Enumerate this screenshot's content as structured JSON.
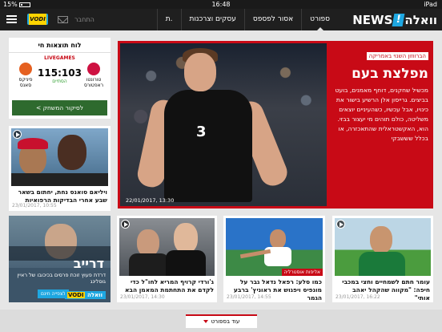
{
  "status": {
    "battery": "15%",
    "time": "16:48",
    "device": "iPad"
  },
  "brand": {
    "walla": "וואלה",
    "news": "NEWS"
  },
  "nav": [
    "ספורט",
    "אסור לפספס",
    "עסקים וצרכנות",
    "ת."
  ],
  "header": {
    "login": "התחבר",
    "vodi": "VODI"
  },
  "hero": {
    "tag": "הברווזון השנוי באמריקה",
    "title": "מפלצת בעם",
    "desc": "מכשיל שחקנים, דוחף מאמנים, בועט בביצים. גרייסון אלן הרשיע בישור את כינויו, אבל עכשיו, כשהעיניים יוצאים משליטה, כולם תוהים מי יעצור בבזי. הוא, האקשטראלית שהתאכזרה, או בכלל שששבקי",
    "date": "22/01/2017, 13:30",
    "jersey": "3"
  },
  "score": {
    "header": "לוח תוצאות חי",
    "logo": "LIVEGAMES",
    "result": "115:103",
    "status": "הסתיים",
    "home": "טורונטו ראפטורס",
    "away": "פיניקס סאנס",
    "button": "לסיקור המשחק >"
  },
  "side": {
    "title": "ויליאם סואנס נחת, יחתום בשאר שבע אחרי הבדיקות הרפואיות",
    "date": "23/01/2017, 10:55"
  },
  "ad": {
    "title": "דרייב",
    "desc": "דרדת פעוץ זוכת פרסים בכיכובו של ראיין גוסלינג",
    "cta": "לצפייה חינם",
    "vodi": "VODI",
    "walla": "וואלה"
  },
  "cards": [
    {
      "title": "ג'ורדי קרויף המריא לחו\"ל כדי לקדם את התחתמת המאמן הבא",
      "date": "23/01/2017, 14:30",
      "badge": ""
    },
    {
      "title": "כמו סלע: רפאל נדאל גבר על מונפיס ויפגוש את ראוניץ' ברבע הגמר",
      "date": "23/01/2017, 14:55",
      "badge": "אליפות אוסטרליה"
    },
    {
      "title": "עומר חתם לשמחיים וחצי במכבי חיפה: \"מקווה שהקהל יאהב אותי\"",
      "date": "23/01/2017, 16:22",
      "badge": ""
    }
  ],
  "more": "עוד בספורט",
  "colors": {
    "accent": "#c80a16",
    "brandBlue": "#1ea7e1",
    "topbar": "#1f1f1f"
  }
}
